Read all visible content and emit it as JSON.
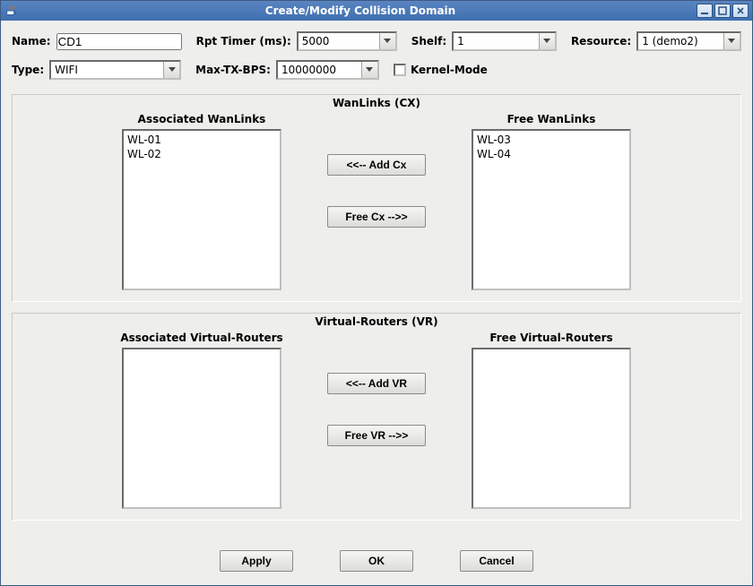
{
  "window": {
    "title": "Create/Modify Collision Domain",
    "app_icon": "java-cup-icon"
  },
  "row1": {
    "name_label": "Name:",
    "name_value": "CD1",
    "rpt_label": "Rpt Timer (ms):",
    "rpt_value": "5000",
    "shelf_label": "Shelf:",
    "shelf_value": "1",
    "resource_label": "Resource:",
    "resource_value": "1 (demo2)"
  },
  "row2": {
    "type_label": "Type:",
    "type_value": "WIFI",
    "maxtx_label": "Max-TX-BPS:",
    "maxtx_value": "10000000",
    "kernel_label": "Kernel-Mode"
  },
  "wanlinks": {
    "group_title": "WanLinks (CX)",
    "assoc_title": "Associated WanLinks",
    "assoc_items": [
      "WL-01",
      "WL-02"
    ],
    "free_title": "Free WanLinks",
    "free_items": [
      "WL-03",
      "WL-04"
    ],
    "add_btn": "<<--  Add Cx",
    "free_btn": "Free Cx -->>"
  },
  "vr": {
    "group_title": "Virtual-Routers (VR)",
    "assoc_title": "Associated Virtual-Routers",
    "assoc_items": [],
    "free_title": "Free Virtual-Routers",
    "free_items": [],
    "add_btn": "<<--  Add VR",
    "free_btn": "Free VR -->>"
  },
  "footer": {
    "apply": "Apply",
    "ok": "OK",
    "cancel": "Cancel"
  }
}
